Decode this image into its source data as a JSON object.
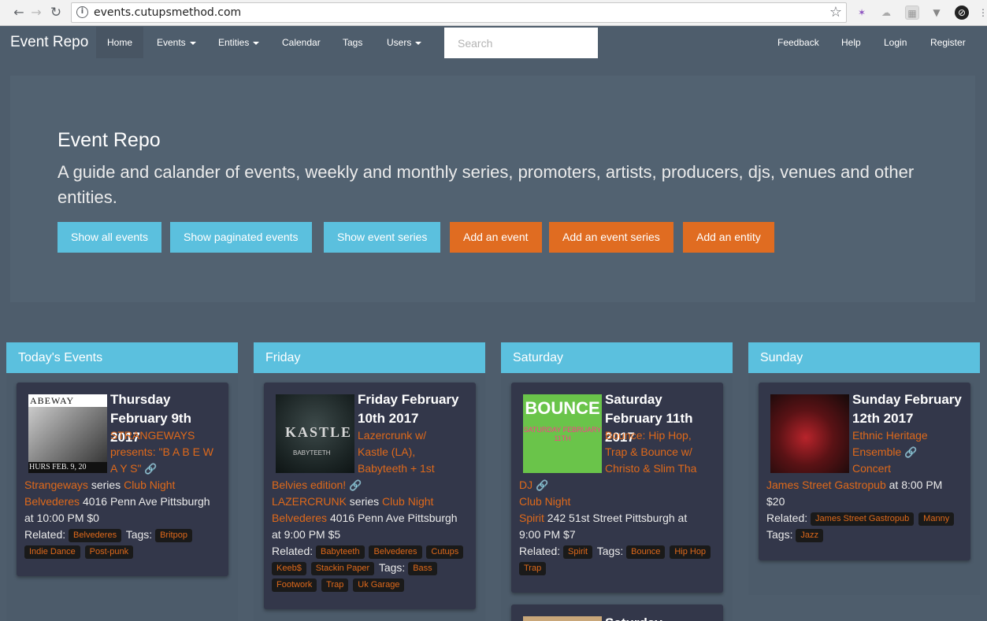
{
  "browser": {
    "url": "events.cutupsmethod.com",
    "back_icon": "←",
    "forward_icon": "→",
    "reload_icon": "↻",
    "info_icon": "i",
    "star_icon": "☆"
  },
  "navbar": {
    "brand": "Event Repo",
    "items": [
      {
        "label": "Home"
      },
      {
        "label": "Events"
      },
      {
        "label": "Entities"
      },
      {
        "label": "Calendar"
      },
      {
        "label": "Tags"
      },
      {
        "label": "Users"
      }
    ],
    "search_placeholder": "Search",
    "right_items": [
      {
        "label": "Feedback"
      },
      {
        "label": "Help"
      },
      {
        "label": "Login"
      },
      {
        "label": "Register"
      }
    ]
  },
  "jumbotron": {
    "title": "Event Repo",
    "lead": "A guide and calander of events, weekly and monthly series, promoters, artists, producers, djs, venues and other entities.",
    "buttons": [
      {
        "label": "Show all events"
      },
      {
        "label": "Show paginated events"
      },
      {
        "label": "Show event series"
      },
      {
        "label": "Add an event"
      },
      {
        "label": "Add an event series"
      },
      {
        "label": "Add an entity"
      }
    ]
  },
  "columns": [
    {
      "heading": "Today's Events",
      "card": {
        "thumb_top": "ABEWAY",
        "thumb_bottom": "HURS FEB. 9, 20",
        "date": "Thursday February 9th 2017",
        "title_a": "STRANGEWAYS",
        "title_b": "presents: \"B A B E W",
        "title_c": "A Y S\"",
        "series": "Strangeways",
        "series_word": "series",
        "type": "Club Night",
        "venue": "Belvederes",
        "address": "4016 Penn Ave Pittsburgh",
        "time": "at 10:00 PM $0",
        "related_label": "Related:",
        "related": [
          "Belvederes"
        ],
        "tags_label": "Tags:",
        "tags": [
          "Britpop",
          "Indie Dance",
          "Post-punk"
        ]
      }
    },
    {
      "heading": "Friday",
      "card": {
        "thumb_main": "KASTLE",
        "thumb_sub": "BABYTEETH",
        "date": "Friday February 10th 2017",
        "title_a": "Lazercrunk w/",
        "title_b": "Kastle (LA),",
        "title_c": "Babyteeth + 1st",
        "title_d": "Belvies edition!",
        "series": "LAZERCRUNK",
        "series_word": "series",
        "type": "Club Night",
        "venue": "Belvederes",
        "address": "4016 Penn Ave Pittsburgh",
        "time": "at 9:00 PM $5",
        "related_label": "Related:",
        "related": [
          "Babyteeth",
          "Belvederes",
          "Cutups",
          "Keeb$",
          "Stackin Paper"
        ],
        "tags_label": "Tags:",
        "tags": [
          "Bass",
          "Footwork",
          "Trap",
          "Uk Garage"
        ]
      }
    },
    {
      "heading": "Saturday",
      "card": {
        "thumb_main": "BOUNCE",
        "thumb_sub": "SATURDAY FEBRUARY 11TH",
        "date": "Saturday February 11th 2017",
        "title_a": "Bounce: Hip Hop,",
        "title_b": "Trap & Bounce w/",
        "title_c": "Christo & Slim Tha",
        "title_d": "DJ",
        "type": "Club Night",
        "venue": "Spirit",
        "address": "242 51st Street Pittsburgh at",
        "time": "9:00 PM $7",
        "related_label": "Related:",
        "related": [
          "Spirit"
        ],
        "tags_label": "Tags:",
        "tags": [
          "Bounce",
          "Hip Hop",
          "Trap"
        ]
      },
      "next_card_date": "Saturday February"
    },
    {
      "heading": "Sunday",
      "card": {
        "date": "Sunday February 12th 2017",
        "title_a": "Ethnic Heritage",
        "title_b": "Ensemble",
        "type": "Concert",
        "venue": "James Street Gastropub",
        "time_a": "at 8:00 PM",
        "time_b": "$20",
        "related_label": "Related:",
        "related": [
          "James Street Gastropub",
          "Manny"
        ],
        "tags_label": "Tags:",
        "tags": [
          "Jazz"
        ]
      }
    }
  ],
  "link_icon": "ὑ7",
  "colors": {
    "accent_info": "#5bc0de",
    "accent_warning": "#df691a",
    "background": "#4e5d6c",
    "card": "#33374a"
  }
}
